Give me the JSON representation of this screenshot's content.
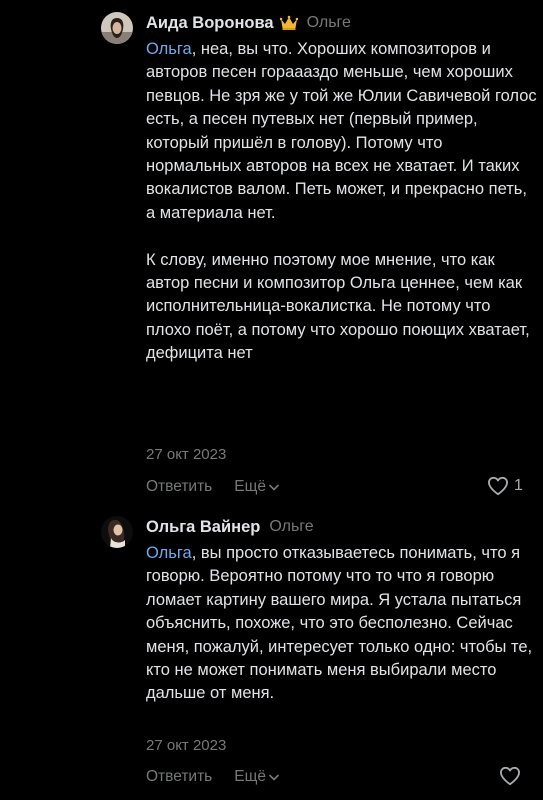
{
  "comments": [
    {
      "author": "Аида Воронова",
      "reply_to": "Ольге",
      "mention": "Ольга",
      "text_first": ", неа, вы что. Хороших композиторов и авторов песен гораааздо меньше, чем хороших певцов. Не зря же у той же Юлии Савичевой голос есть, а песен путевых нет (первый пример, который пришёл в голову). Потому что нормальных авторов на всех не хватает. И таких вокалистов валом. Петь может, и прекрасно петь, а материала нет.",
      "text_second": "К слову, именно поэтому мое мнение, что как автор песни и композитор Ольга ценнее, чем как исполнительница-вокалистка. Не потому что плохо поёт, а потому что хорошо поющих хватает, дефицита нет",
      "date": "27 окт 2023",
      "reply_label": "Ответить",
      "more_label": "Ещё",
      "likes": "1",
      "badge_icon": "crown-icon"
    },
    {
      "author": "Ольга Вайнер",
      "reply_to": "Ольге",
      "mention": "Ольга",
      "text_first": ", вы просто отказываетесь понимать, что я говорю. Вероятно потому что то что я говорю ломает картину вашего мира. Я устала пытаться объяснить, похоже, что это бесполезно. Сейчас меня, пожалуй, интересует только одно: чтобы те, кто не может понимать меня выбирали место дальше от меня.",
      "date": "27 окт 2023",
      "reply_label": "Ответить",
      "more_label": "Ещё",
      "likes": ""
    }
  ],
  "colors": {
    "background": "#000000",
    "text": "#e1e3e6",
    "secondary": "#76787a",
    "link": "#71aaeb",
    "crown": "#f2b632"
  }
}
